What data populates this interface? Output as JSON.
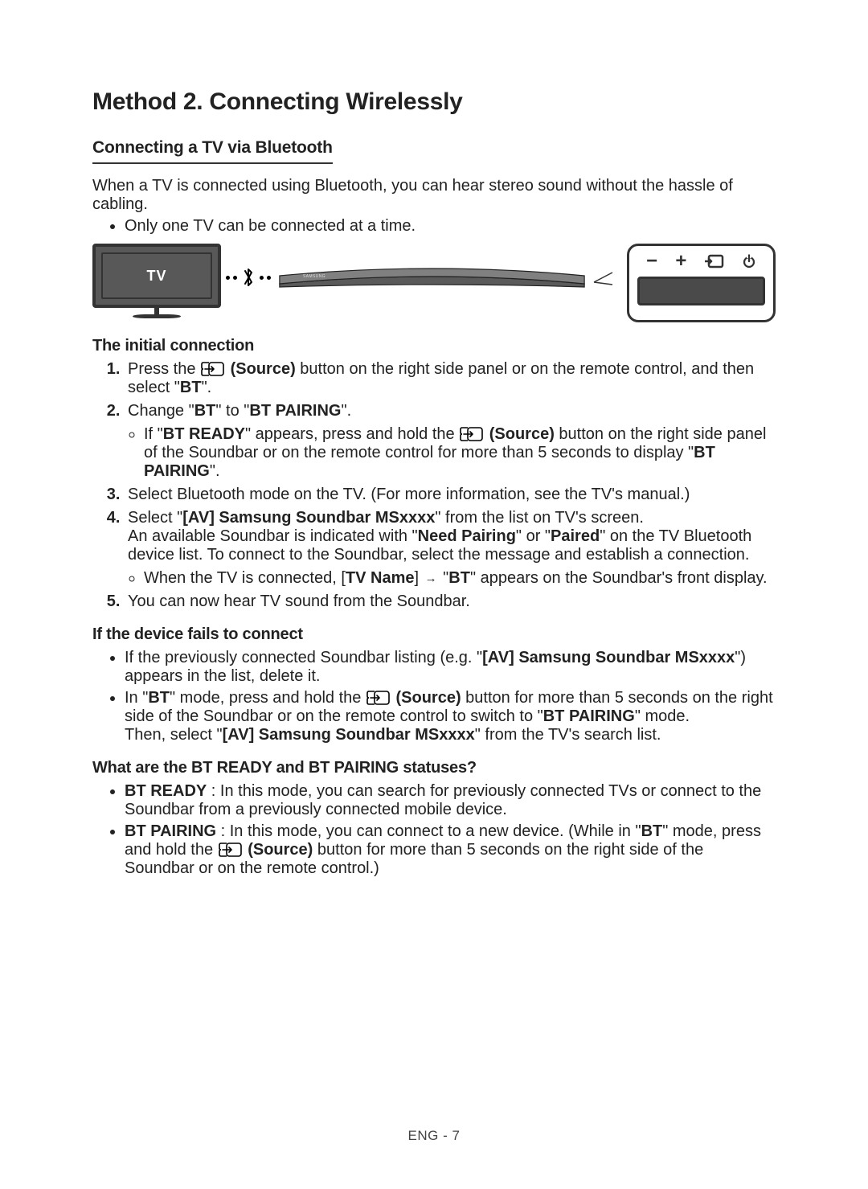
{
  "h1": "Method 2. Connecting Wirelessly",
  "h2": "Connecting a TV via Bluetooth",
  "intro": "When a TV is connected using Bluetooth, you can hear stereo sound without the hassle of cabling.",
  "intro_bullet": "Only one TV can be connected at a time.",
  "diagram": {
    "tv_label": "TV"
  },
  "initial_h": "The initial connection",
  "step1": {
    "a": "Press the ",
    "src": " (Source)",
    "b": " button on the right side panel or on the remote control, and then select \"",
    "bt": "BT",
    "c": "\"."
  },
  "step2": {
    "a": "Change \"",
    "bt": "BT",
    "b": "\" to \"",
    "bp": "BT PAIRING",
    "c": "\".",
    "sub_a": "If \"",
    "ready": "BT READY",
    "sub_b": "\" appears, press and hold the ",
    "src": " (Source)",
    "sub_c": " button on the right side panel of the Soundbar or on the remote control for more than 5 seconds to display \"",
    "bp2": "BT PAIRING",
    "sub_d": "\"."
  },
  "step3": "Select Bluetooth mode on the TV. (For more information, see the TV's manual.)",
  "step4": {
    "a": "Select \"",
    "name": "[AV] Samsung Soundbar MSxxxx",
    "b": "\" from the list on TV's screen.",
    "line2a": "An available Soundbar is indicated with \"",
    "need": "Need Pairing",
    "line2b": "\" or \"",
    "paired": "Paired",
    "line2c": "\" on the TV Bluetooth device list. To connect to the Soundbar, select the message and establish a connection.",
    "sub_a": "When the TV is connected, [",
    "tvname": "TV Name",
    "sub_b": "] ",
    "sub_c": " \"",
    "bt": "BT",
    "sub_d": "\" appears on the Soundbar's front display."
  },
  "step5": "You can now hear TV sound from the Soundbar.",
  "fail_h": "If the device fails to connect",
  "fail1": {
    "a": "If the previously connected Soundbar listing (e.g. \"",
    "name": "[AV] Samsung Soundbar MSxxxx",
    "b": "\") appears in the list, delete it."
  },
  "fail2": {
    "a": "In \"",
    "bt": "BT",
    "b": "\" mode, press and hold the ",
    "src": " (Source)",
    "c": " button for more than 5 seconds on the right side of the Soundbar or on the remote control to switch to \"",
    "bp": "BT PAIRING",
    "d": "\" mode.",
    "line2a": "Then, select \"",
    "name": "[AV] Samsung Soundbar MSxxxx",
    "line2b": "\" from the TV's search list."
  },
  "status_h": "What are the BT READY and BT PAIRING statuses?",
  "status1": {
    "label": "BT READY",
    "text": " : In this mode, you can search for previously connected TVs or connect to the Soundbar from a previously connected mobile device."
  },
  "status2": {
    "label": "BT PAIRING",
    "a": " : In this mode, you can connect to a new device. (While in \"",
    "bt": "BT",
    "b": "\" mode, press and hold the ",
    "src": " (Source)",
    "c": " button for more than 5 seconds on the right side of the Soundbar or on the remote control.)"
  },
  "footer": "ENG - 7"
}
